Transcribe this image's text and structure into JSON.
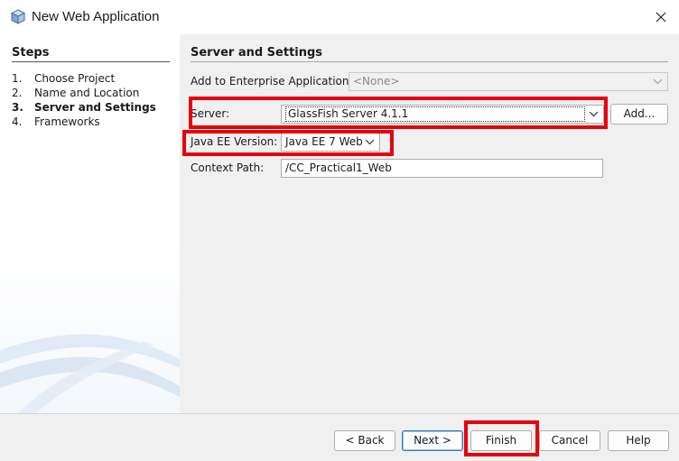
{
  "window": {
    "title": "New Web Application",
    "icon": "netbeans-cube-icon"
  },
  "steps": {
    "title": "Steps",
    "items": [
      {
        "num": "1.",
        "label": "Choose Project"
      },
      {
        "num": "2.",
        "label": "Name and Location"
      },
      {
        "num": "3.",
        "label": "Server and Settings"
      },
      {
        "num": "4.",
        "label": "Frameworks"
      }
    ],
    "current_index": 2
  },
  "content": {
    "section_title": "Server and Settings",
    "enterprise_label": "Add to Enterprise Application:",
    "enterprise_value": "<None>",
    "server_label": "Server:",
    "server_value": "GlassFish Server 4.1.1",
    "add_label": "Add...",
    "javaee_label": "Java EE Version:",
    "javaee_value": "Java EE 7 Web",
    "context_label": "Context Path:",
    "context_value": "/CC_Practical1_Web"
  },
  "buttons": {
    "back": "< Back",
    "next": "Next >",
    "finish": "Finish",
    "cancel": "Cancel",
    "help": "Help"
  },
  "colors": {
    "highlight": "#e8000b",
    "content_bg": "#f0f0f0",
    "default_button_border": "#2a7ab8"
  }
}
